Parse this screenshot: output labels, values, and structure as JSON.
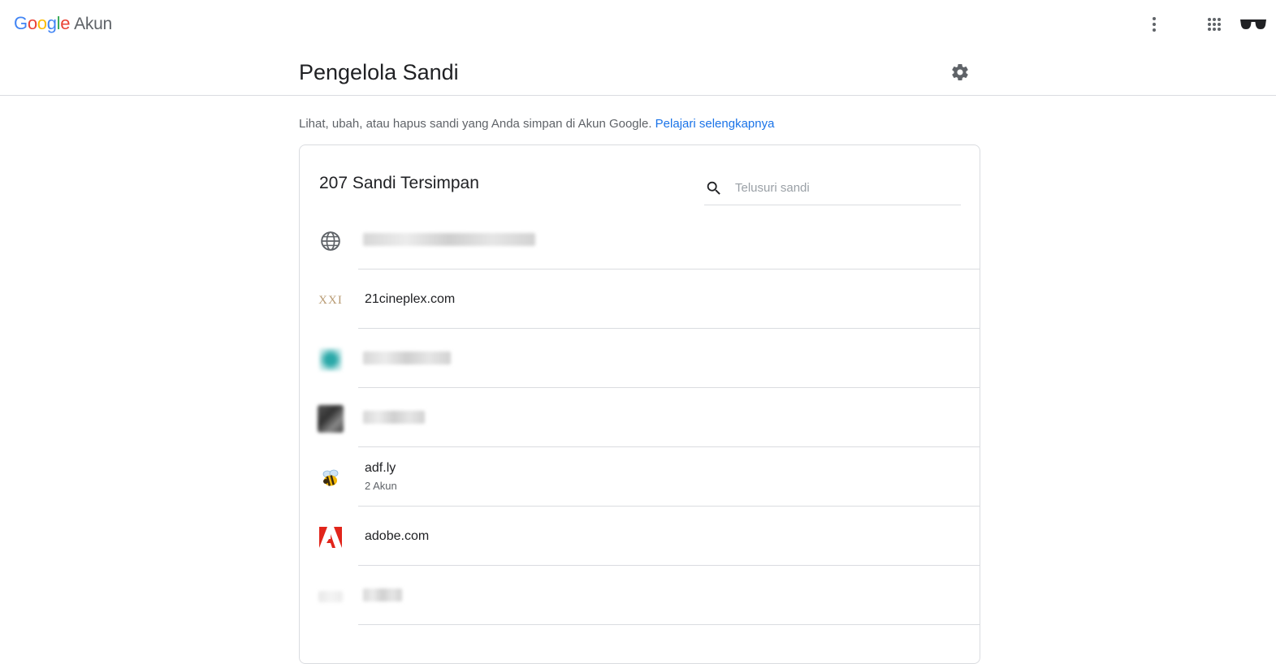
{
  "app": {
    "logo_text": "Google",
    "product": "Akun"
  },
  "header": {
    "title": "Pengelola Sandi"
  },
  "intro": {
    "text": "Lihat, ubah, atau hapus sandi yang Anda simpan di Akun Google.",
    "link": "Pelajari selengkapnya"
  },
  "card": {
    "title": "207 Sandi Tersimpan",
    "search_placeholder": "Telusuri sandi"
  },
  "icons": {
    "more": "more-vert-icon",
    "apps": "apps-grid-icon",
    "avatar": "sunglasses-avatar-icon",
    "settings": "gear-icon",
    "search": "search-icon",
    "globe": "globe-icon"
  },
  "colors": {
    "accent": "#1a73e8",
    "divider": "#dadce0",
    "text_secondary": "#5f6368"
  },
  "passwords": [
    {
      "name": "",
      "sub": "",
      "blurred": true
    },
    {
      "name": "21cineplex.com",
      "sub": ""
    },
    {
      "name": "",
      "sub": "",
      "blurred": true
    },
    {
      "name": "",
      "sub": "",
      "blurred": true
    },
    {
      "name": "adf.ly",
      "sub": "2 Akun"
    },
    {
      "name": "adobe.com",
      "sub": ""
    },
    {
      "name": "",
      "sub": "",
      "blurred": true
    }
  ]
}
